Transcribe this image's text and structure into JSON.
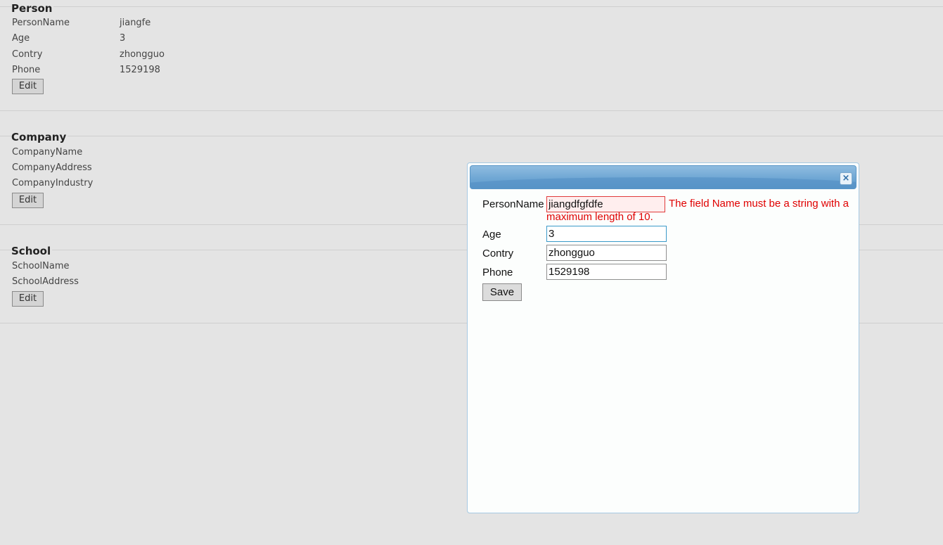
{
  "person": {
    "legend": "Person",
    "fields": [
      {
        "label": "PersonName",
        "value": "jiangfe"
      },
      {
        "label": "Age",
        "value": "3"
      },
      {
        "label": "Contry",
        "value": "zhongguo"
      },
      {
        "label": "Phone",
        "value": "1529198"
      }
    ],
    "edit_label": "Edit"
  },
  "company": {
    "legend": "Company",
    "fields": [
      {
        "label": "CompanyName",
        "value": ""
      },
      {
        "label": "CompanyAddress",
        "value": ""
      },
      {
        "label": "CompanyIndustry",
        "value": ""
      }
    ],
    "edit_label": "Edit"
  },
  "school": {
    "legend": "School",
    "fields": [
      {
        "label": "SchoolName",
        "value": ""
      },
      {
        "label": "SchoolAddress",
        "value": ""
      }
    ],
    "edit_label": "Edit"
  },
  "dialog": {
    "close_icon": "×",
    "fields": [
      {
        "label": "PersonName",
        "value": "jiangdfgfdfe"
      },
      {
        "label": "Age",
        "value": "3"
      },
      {
        "label": "Contry",
        "value": "zhongguo"
      },
      {
        "label": "Phone",
        "value": "1529198"
      }
    ],
    "error_message": "The field Name must be a string with a maximum length of 10.",
    "save_label": "Save"
  }
}
